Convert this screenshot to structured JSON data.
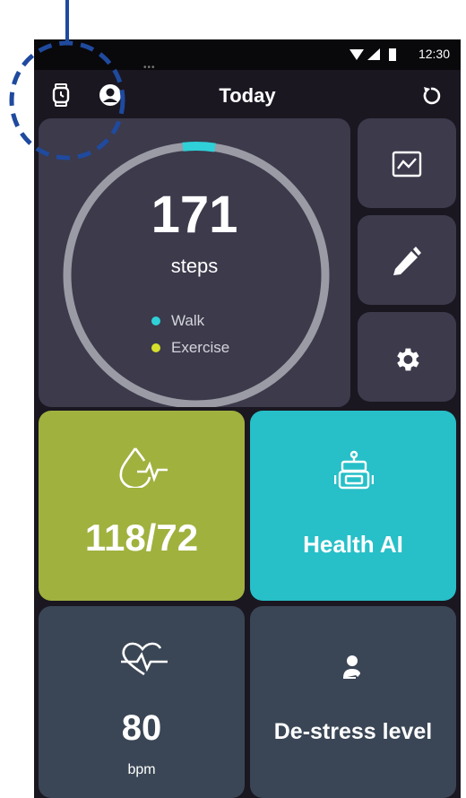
{
  "status_bar": {
    "time": "12:30"
  },
  "header": {
    "title": "Today"
  },
  "steps": {
    "count": "171",
    "unit": "steps",
    "progress": 0.04,
    "legend": [
      {
        "label": "Walk",
        "color": "#2fd0d8"
      },
      {
        "label": "Exercise",
        "color": "#d6e02c"
      }
    ]
  },
  "blood_pressure": {
    "value": "118/72"
  },
  "health_ai": {
    "label": "Health AI"
  },
  "heart_rate": {
    "value": "80",
    "unit": "bpm"
  },
  "destress": {
    "label": "De-stress level"
  },
  "colors": {
    "background": "#1a1721",
    "card": "#3c3a4b",
    "bp_card": "#a0b13e",
    "ai_card": "#27bfc8",
    "hr_card": "#3a4655",
    "annotation": "#1f4a9e",
    "accent": "#2fd0d8"
  },
  "icons": [
    "watch-icon",
    "profile-icon",
    "refresh-icon",
    "chart-icon",
    "pencil-icon",
    "gear-icon",
    "blood-drop-pulse-icon",
    "robot-icon",
    "heart-pulse-icon",
    "person-heart-icon"
  ]
}
